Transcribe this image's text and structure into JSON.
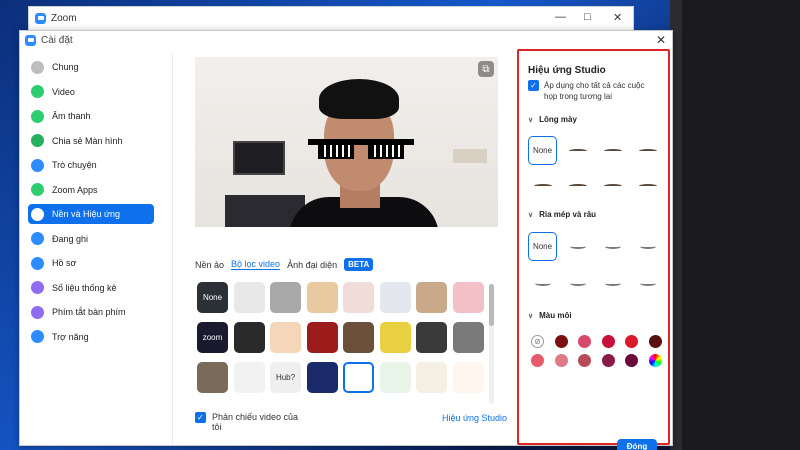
{
  "bg_window": {
    "title": "Zoom"
  },
  "window": {
    "title": "Cài đặt"
  },
  "sidebar": {
    "items": [
      {
        "label": "Chung",
        "icon": "gear-icon",
        "color": "#bdbdbd"
      },
      {
        "label": "Video",
        "icon": "video-icon",
        "color": "#2ecc71"
      },
      {
        "label": "Âm thanh",
        "icon": "headphones-icon",
        "color": "#2ecc71"
      },
      {
        "label": "Chia sẻ Màn hình",
        "icon": "share-screen-icon",
        "color": "#27ae60"
      },
      {
        "label": "Trò chuyện",
        "icon": "chat-icon",
        "color": "#2d8cff"
      },
      {
        "label": "Zoom Apps",
        "icon": "apps-icon",
        "color": "#2ecc71"
      },
      {
        "label": "Nền và Hiệu ứng",
        "icon": "background-icon",
        "color": "#ffffff"
      },
      {
        "label": "Đang ghi",
        "icon": "record-icon",
        "color": "#2d8cff"
      },
      {
        "label": "Hồ sơ",
        "icon": "profile-icon",
        "color": "#2d8cff"
      },
      {
        "label": "Số liệu thống kê",
        "icon": "stats-icon",
        "color": "#8e6cf0"
      },
      {
        "label": "Phím tắt bàn phím",
        "icon": "keyboard-icon",
        "color": "#8e6cf0"
      },
      {
        "label": "Trợ năng",
        "icon": "accessibility-icon",
        "color": "#2d8cff"
      }
    ],
    "active_index": 6
  },
  "tabs": {
    "items": [
      "Nền ảo",
      "Bộ lọc video",
      "Ảnh đại diện"
    ],
    "active": "Bộ lọc video",
    "beta": "BETA"
  },
  "filters": {
    "none_label": "None",
    "colors": [
      "#2b2f36",
      "#e8e8e8",
      "#a8a8a8",
      "#e8c9a0",
      "#f0dcd8",
      "#e4e8ee",
      "#c9a98a",
      "#f4c0c8",
      "#1a1a2e",
      "#2a2a2a",
      "#f4d6b8",
      "#9c1c1c",
      "#6b4f3a",
      "#e8d040",
      "#3a3a3a",
      "#7a7a7a",
      "#7a6a5a",
      "#f2f2f2",
      "#efefef",
      "#1a2a6a",
      "#ffffff",
      "#eaf5ea",
      "#f6f0e4",
      "#fff6f0"
    ],
    "labels": {
      "zoom": "zoom",
      "hub": "Hub?"
    }
  },
  "mirror": {
    "label": "Phản chiếu video của tôi",
    "checked": true
  },
  "studio_link": "Hiệu ứng Studio",
  "studio": {
    "title": "Hiệu ứng Studio",
    "apply_all": "Áp dụng cho tất cả các cuộc họp trong tương lai",
    "eyebrows": {
      "title": "Lông mày",
      "none": "None"
    },
    "mustache": {
      "title": "Ria mép và râu",
      "none": "None"
    },
    "lip_color": {
      "title": "Màu môi",
      "swatches": [
        "#7a1010",
        "#d64a6a",
        "#c8103a",
        "#d81a2a",
        "#5a1010",
        "#e65a6a",
        "#e07a8a",
        "#b84a5a",
        "#8a1a4a",
        "#6a0a3a"
      ]
    },
    "close": "Đóng"
  }
}
